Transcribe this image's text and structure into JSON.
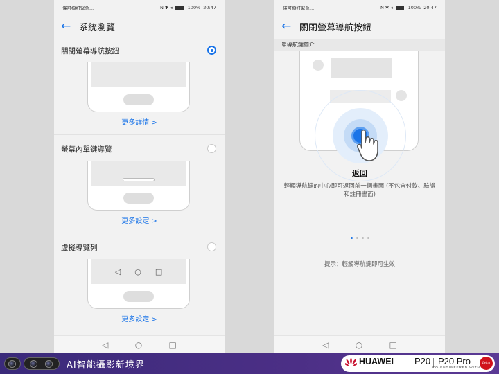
{
  "status_bar": {
    "left_text": "僅可撥打緊急...",
    "battery": "100%",
    "time": "20:47"
  },
  "screen1": {
    "title": "系統瀏覽",
    "options": [
      {
        "label": "關閉螢幕導航按鈕",
        "selected": true,
        "link": "更多詳情 >"
      },
      {
        "label": "螢幕內單鍵導覽",
        "selected": false,
        "link": "更多設定 >"
      },
      {
        "label": "虛擬導覽列",
        "selected": false,
        "link": "更多設定 >"
      }
    ]
  },
  "screen2": {
    "title": "關閉螢幕導航按鈕",
    "section_label": "單導航鍵簡介",
    "gesture_title": "返回",
    "gesture_desc": "輕觸導航鍵的中心即可返回前一個畫面 (不包含付款、驗證和註冊畫面)",
    "page_indicator": {
      "total": 4,
      "current": 1
    },
    "hint": "提示：輕觸導航鍵即可生效"
  },
  "nav_icons": [
    "back-triangle",
    "home-circle",
    "recents-square"
  ],
  "footer": {
    "tagline": "AI智能攝影新境界",
    "brand": "HUAWEI",
    "model1": "P20",
    "model2": "P20 Pro",
    "coengineered": "CO-ENGINEERED WITH",
    "leica": "Leica"
  },
  "colors": {
    "accent": "#1a74e8",
    "footer_purple": "#4c2f86",
    "huawei_red": "#c8102e"
  }
}
